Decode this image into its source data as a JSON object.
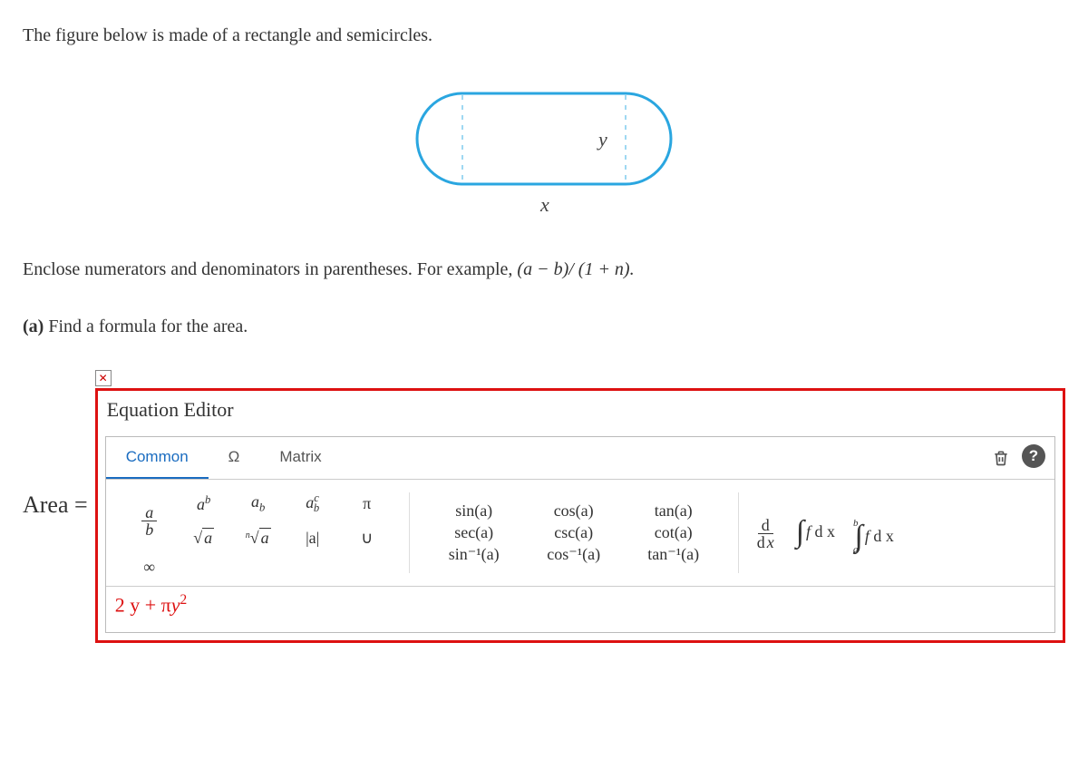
{
  "problem": {
    "intro": "The figure below is made of a rectangle and semicircles.",
    "figure": {
      "x_label": "x",
      "y_label": "y"
    },
    "instruction_prefix": "Enclose numerators and denominators in parentheses. For example, ",
    "instruction_example": "(a − b)/ (1 + n).",
    "part_a_label": "(a)",
    "part_a_text": " Find a formula for the area.",
    "area_label": "Area ="
  },
  "editor": {
    "title": "Equation Editor",
    "tabs": {
      "common": "Common",
      "omega": "Ω",
      "matrix": "Matrix"
    },
    "icons": {
      "trash": "trash-icon",
      "help": "?"
    },
    "ops": {
      "frac": {
        "num": "a",
        "den": "b"
      },
      "pow": "a",
      "pow_exp": "b",
      "sub_": "a",
      "sub_b": "b",
      "powsub": "a",
      "powsub_sup": "c",
      "powsub_sub": "b",
      "pi": "π",
      "sqrt": "a",
      "nroot": "a",
      "nroot_n": "n",
      "abs": "|a|",
      "union": "∪",
      "inf": "∞",
      "sin": "sin(a)",
      "cos": "cos(a)",
      "tan": "tan(a)",
      "sec": "sec(a)",
      "csc": "csc(a)",
      "cot": "cot(a)",
      "asin": "sin⁻¹(a)",
      "acos": "cos⁻¹(a)",
      "atan": "tan⁻¹(a)",
      "deriv_num": "d",
      "deriv_den": "d",
      "deriv_var": "x",
      "int": "∫",
      "int_fx": "f ",
      "int_dx": "d x",
      "dint": "∫",
      "dint_a": "a",
      "dint_b": "b",
      "dint_fx": "f ",
      "dint_dx": "d x"
    },
    "answer_prefix": "2 y + π",
    "answer_var": "y",
    "answer_exp": "2"
  }
}
